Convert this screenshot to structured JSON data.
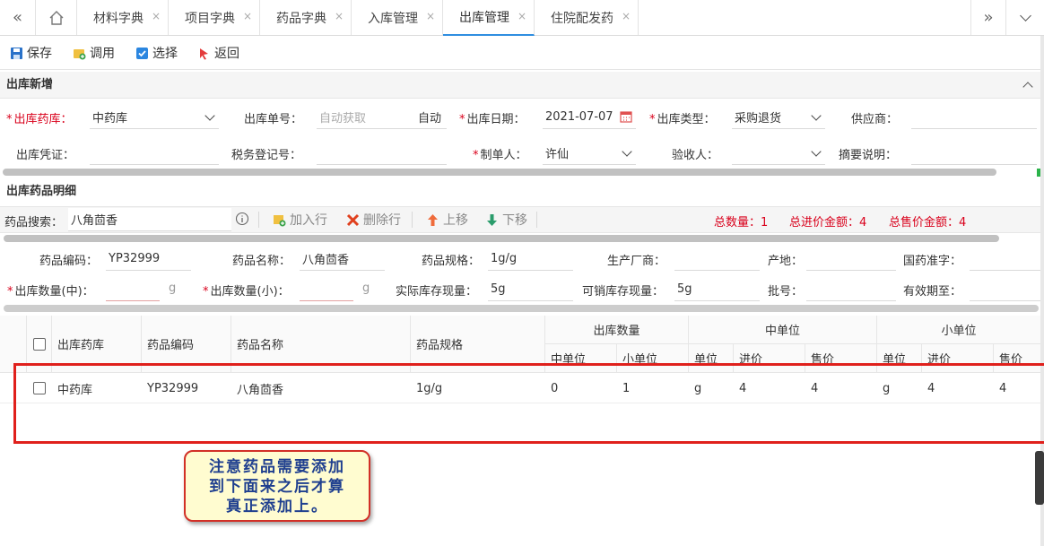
{
  "tabs": {
    "items": [
      {
        "label": "材料字典"
      },
      {
        "label": "项目字典"
      },
      {
        "label": "药品字典"
      },
      {
        "label": "入库管理"
      },
      {
        "label": "出库管理"
      },
      {
        "label": "住院配发药"
      }
    ],
    "active": "出库管理",
    "close_glyph": "×"
  },
  "toolbar": {
    "save": "保存",
    "invoke": "调用",
    "select": "选择",
    "back": "返回"
  },
  "section1": {
    "title": "出库新增",
    "fields": {
      "warehouse_label": "出库药库：",
      "warehouse_value": "中药库",
      "order_no_label": "出库单号：",
      "order_no_placeholder": "自动获取",
      "order_no_suffix": "自动",
      "date_label": "出库日期：",
      "date_value": "2021-07-07",
      "type_label": "出库类型：",
      "type_value": "采购退货",
      "supplier_label": "供应商：",
      "voucher_label": "出库凭证：",
      "tax_label": "税务登记号：",
      "maker_label": "制单人：",
      "maker_value": "许仙",
      "checker_label": "验收人：",
      "summary_label": "摘要说明："
    }
  },
  "section2": {
    "title": "出库药品明细",
    "search_label": "药品搜索：",
    "search_value": "八角茴香",
    "add_row": "加入行",
    "delete_row": "删除行",
    "move_up": "上移",
    "move_down": "下移",
    "total_qty": "总数量：1",
    "total_purchase": "总进价金额：4",
    "total_sale": "总售价金额：4",
    "detail": {
      "code_label": "药品编码：",
      "code_value": "YP32999",
      "name_label": "药品名称：",
      "name_value": "八角茴香",
      "spec_label": "药品规格：",
      "spec_value": "1g/g",
      "maker_label": "生产厂商：",
      "origin_label": "产地：",
      "approval_label": "国药准字：",
      "qty_mid_label": "出库数量(中)：",
      "qty_mid_unit": "g",
      "qty_small_label": "出库数量(小)：",
      "qty_small_unit": "g",
      "actual_stock_label": "实际库存现量：",
      "actual_stock_value": "5g",
      "sellable_stock_label": "可销库存现量：",
      "sellable_stock_value": "5g",
      "batch_label": "批号：",
      "expiry_label": "有效期至："
    }
  },
  "table": {
    "headers": {
      "warehouse": "出库药库",
      "code": "药品编码",
      "name": "药品名称",
      "spec": "药品规格",
      "out_qty": "出库数量",
      "mid_unit_group": "中单位",
      "small_unit_group": "小单位",
      "qty_mid": "中单位",
      "qty_small": "小单位",
      "mid_unit": "单位",
      "mid_price": "进价",
      "mid_sale": "售价",
      "small_unit": "单位",
      "small_price": "进价",
      "small_sale": "售价"
    },
    "rows": [
      {
        "warehouse": "中药库",
        "code": "YP32999",
        "name": "八角茴香",
        "spec": "1g/g",
        "qty_mid": "0",
        "qty_small": "1",
        "mid_unit": "g",
        "mid_price": "4",
        "mid_sale": "4",
        "small_unit": "g",
        "small_price": "4",
        "small_sale": "4"
      }
    ]
  },
  "callout": {
    "line1": "注意药品需要添加",
    "line2": "到下面来之后才算",
    "line3": "真正添加上。"
  },
  "colors": {
    "accent": "#2f8ee0",
    "required": "#d9001b",
    "totals": "#d9001b",
    "annotation_border": "#e0201c"
  }
}
